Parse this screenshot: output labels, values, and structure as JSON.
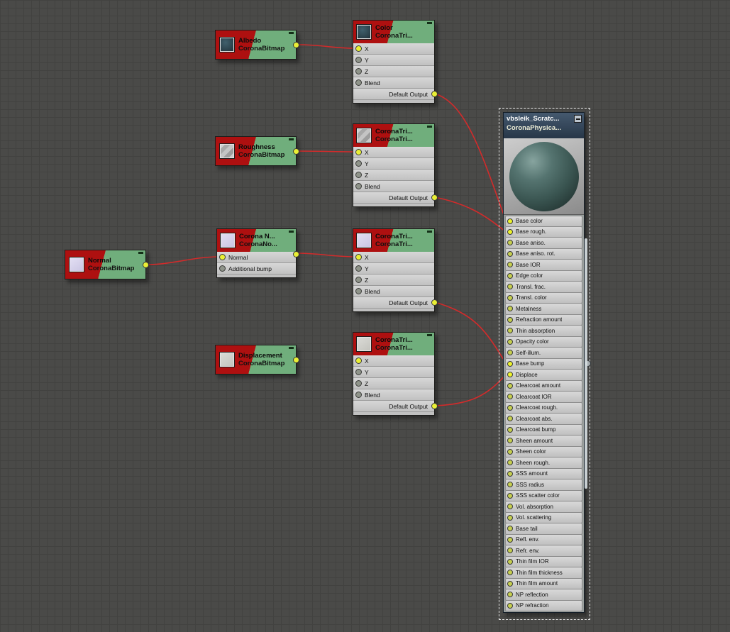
{
  "editor": {
    "bg": "#4a4a48",
    "grid_line": "#424240",
    "wire_color": "#d22b2b",
    "header_red": "#ae1010",
    "header_green": "#70ae7c",
    "dot_connected": "#e9ef35",
    "dot_idle": "#8f948a"
  },
  "nodes": {
    "albedo": {
      "title": "Albedo",
      "class_name": "CoronaBitmap"
    },
    "roughness": {
      "title": "Roughness",
      "class_name": "CoronaBitmap"
    },
    "normal_bitmap": {
      "title": "Normal",
      "class_name": "CoronaBitmap"
    },
    "displacement": {
      "title": "Displacement",
      "class_name": "CoronaBitmap"
    },
    "tri_color": {
      "title": "Color",
      "class_name": "CoronaTri...",
      "inputs": [
        "X",
        "Y",
        "Z",
        "Blend"
      ],
      "output_label": "Default Output"
    },
    "tri_roughness": {
      "title": "CoronaTri...",
      "class_name": "CoronaTri...",
      "inputs": [
        "X",
        "Y",
        "Z",
        "Blend"
      ],
      "output_label": "Default Output"
    },
    "tri_normal": {
      "title": "CoronaTri...",
      "class_name": "CoronaTri...",
      "inputs": [
        "X",
        "Y",
        "Z",
        "Blend"
      ],
      "output_label": "Default Output"
    },
    "tri_displacement": {
      "title": "CoronaTri...",
      "class_name": "CoronaTri...",
      "inputs": [
        "X",
        "Y",
        "Z",
        "Blend"
      ],
      "output_label": "Default Output"
    },
    "corona_normal": {
      "title": "Corona N...",
      "class_name": "CoronaNo...",
      "inputs": [
        "Normal",
        "Additional bump"
      ]
    },
    "material": {
      "title": "vbsleik_Scratc...",
      "class_name": "CoronaPhysica...",
      "slots": [
        {
          "label": "Base color",
          "connected": true
        },
        {
          "label": "Base rough.",
          "connected": true
        },
        {
          "label": "Base aniso.",
          "connected": false
        },
        {
          "label": "Base aniso. rot.",
          "connected": false
        },
        {
          "label": "Base IOR",
          "connected": false
        },
        {
          "label": "Edge color",
          "connected": false
        },
        {
          "label": "Transl. frac.",
          "connected": false
        },
        {
          "label": "Transl. color",
          "connected": false
        },
        {
          "label": "Metalness",
          "connected": false
        },
        {
          "label": "Refraction amount",
          "connected": false
        },
        {
          "label": "Thin absorption",
          "connected": false
        },
        {
          "label": "Opacity color",
          "connected": false
        },
        {
          "label": "Self-illum.",
          "connected": false
        },
        {
          "label": "Base bump",
          "connected": true
        },
        {
          "label": "Displace",
          "connected": true
        },
        {
          "label": "Clearcoat amount",
          "connected": false
        },
        {
          "label": "Clearcoat IOR",
          "connected": false
        },
        {
          "label": "Clearcoat rough.",
          "connected": false
        },
        {
          "label": "Clearcoat abs.",
          "connected": false
        },
        {
          "label": "Clearcoat bump",
          "connected": false
        },
        {
          "label": "Sheen amount",
          "connected": false
        },
        {
          "label": "Sheen color",
          "connected": false
        },
        {
          "label": "Sheen rough.",
          "connected": false
        },
        {
          "label": "SSS amount",
          "connected": false
        },
        {
          "label": "SSS radius",
          "connected": false
        },
        {
          "label": "SSS scatter color",
          "connected": false
        },
        {
          "label": "Vol. absorption",
          "connected": false
        },
        {
          "label": "Vol. scattering",
          "connected": false
        },
        {
          "label": "Base tail",
          "connected": false
        },
        {
          "label": "Refl. env.",
          "connected": false
        },
        {
          "label": "Refr. env.",
          "connected": false
        },
        {
          "label": "Thin film IOR",
          "connected": false
        },
        {
          "label": "Thin film thickness",
          "connected": false
        },
        {
          "label": "Thin film amount",
          "connected": false
        },
        {
          "label": "NP reflection",
          "connected": false
        },
        {
          "label": "NP refraction",
          "connected": false
        }
      ]
    }
  },
  "connections": [
    {
      "from": "Albedo CoronaBitmap",
      "to": "Color CoronaTri X"
    },
    {
      "from": "Color CoronaTri Default Output",
      "to": "Base color"
    },
    {
      "from": "Roughness CoronaBitmap",
      "to": "CoronaTri X"
    },
    {
      "from": "Roughness CoronaTri Default Output",
      "to": "Base rough."
    },
    {
      "from": "Normal CoronaBitmap",
      "to": "CoronaNormal Normal"
    },
    {
      "from": "CoronaNormal",
      "to": "CoronaTri X"
    },
    {
      "from": "Normal CoronaTri Default Output",
      "to": "Base bump"
    },
    {
      "from": "Displacement CoronaTri Default Output",
      "to": "Displace"
    }
  ]
}
